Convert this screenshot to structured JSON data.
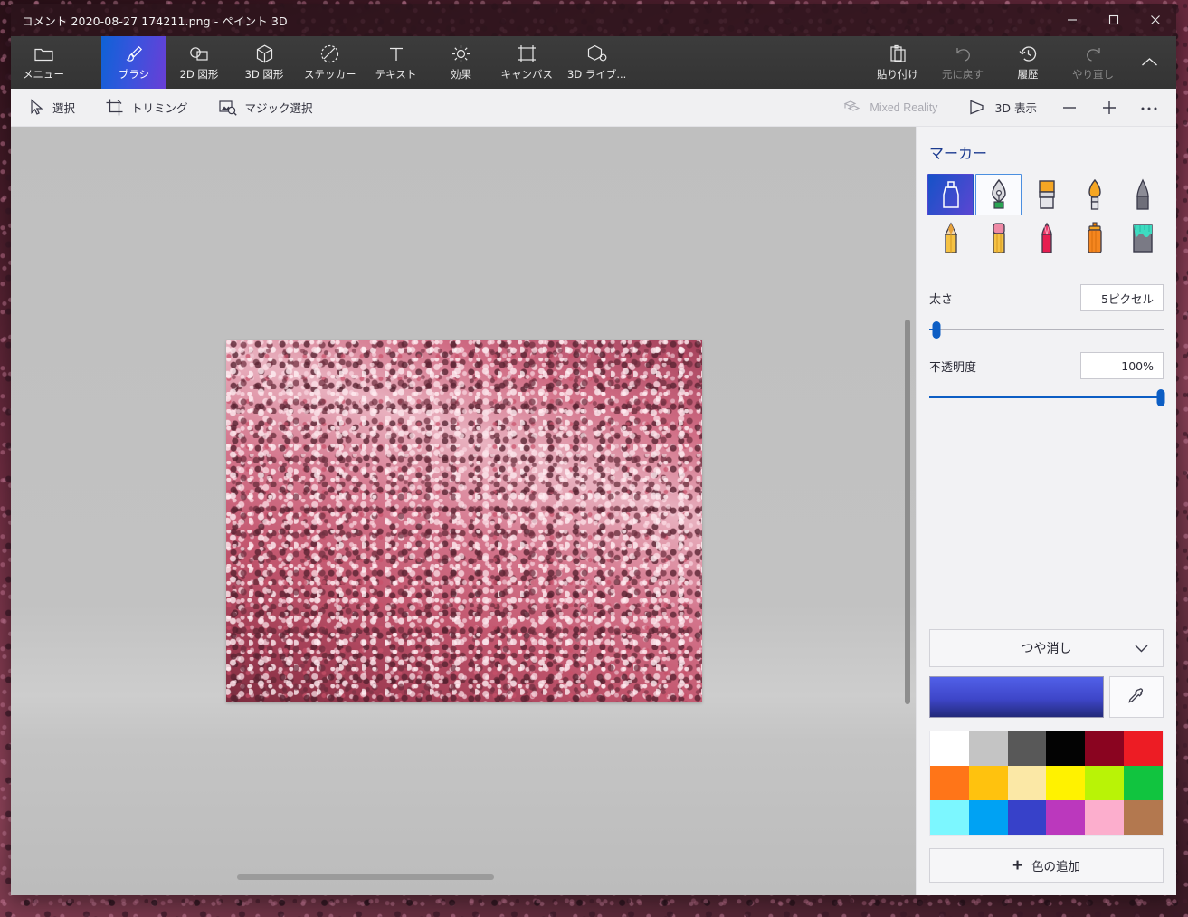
{
  "window": {
    "title": "コメント 2020-08-27 174211.png - ペイント 3D",
    "controls": [
      {
        "name": "minimize",
        "glyph": "minimize-icon"
      },
      {
        "name": "maximize",
        "glyph": "maximize-icon"
      },
      {
        "name": "close",
        "glyph": "close-icon"
      }
    ]
  },
  "ribbon": {
    "menu": {
      "label": "メニュー",
      "icon": "folder-icon"
    },
    "tools": [
      {
        "label": "ブラシ",
        "icon": "brush-icon",
        "active": true,
        "disabled": false
      },
      {
        "label": "2D 図形",
        "icon": "shapes-2d-icon",
        "active": false,
        "disabled": false
      },
      {
        "label": "3D 図形",
        "icon": "cube-3d-icon",
        "active": false,
        "disabled": false
      },
      {
        "label": "ステッカー",
        "icon": "sticker-icon",
        "active": false,
        "disabled": false
      },
      {
        "label": "テキスト",
        "icon": "text-icon",
        "active": false,
        "disabled": false
      },
      {
        "label": "効果",
        "icon": "effects-sun-icon",
        "active": false,
        "disabled": false
      },
      {
        "label": "キャンバス",
        "icon": "canvas-frame-icon",
        "active": false,
        "disabled": false
      },
      {
        "label": "3D ライブ...",
        "icon": "3d-library-icon",
        "active": false,
        "disabled": false
      }
    ],
    "right": [
      {
        "label": "貼り付け",
        "icon": "paste-icon",
        "disabled": false
      },
      {
        "label": "元に戻す",
        "icon": "undo-icon",
        "disabled": true
      },
      {
        "label": "履歴",
        "icon": "history-icon",
        "disabled": false
      },
      {
        "label": "やり直し",
        "icon": "redo-icon",
        "disabled": true
      }
    ],
    "collapse": {
      "icon": "chevron-up-icon"
    }
  },
  "subbar": {
    "left": [
      {
        "label": "選択",
        "icon": "cursor-select-icon",
        "disabled": false
      },
      {
        "label": "トリミング",
        "icon": "crop-icon",
        "disabled": false
      },
      {
        "label": "マジック選択",
        "icon": "magic-select-icon",
        "disabled": false
      }
    ],
    "right": [
      {
        "label": "Mixed Reality",
        "icon": "mixed-reality-icon",
        "disabled": true
      },
      {
        "label": "3D 表示",
        "icon": "view-3d-icon",
        "disabled": false
      }
    ],
    "zoom_out": {
      "icon": "minus-icon",
      "glyph": "—"
    },
    "zoom_in": {
      "icon": "plus-icon",
      "glyph": "+"
    },
    "more": {
      "icon": "more-ellipsis-icon",
      "glyph": "···"
    }
  },
  "panel": {
    "title": "マーカー",
    "brushes": [
      {
        "name": "marker-brush",
        "selected": true,
        "hovered": false
      },
      {
        "name": "calligraphy-pen-brush",
        "selected": false,
        "hovered": true
      },
      {
        "name": "oil-brush",
        "selected": false,
        "hovered": false
      },
      {
        "name": "watercolor-brush",
        "selected": false,
        "hovered": false
      },
      {
        "name": "pixel-pen-brush",
        "selected": false,
        "hovered": false
      },
      {
        "name": "pencil-brush",
        "selected": false,
        "hovered": false
      },
      {
        "name": "eraser-brush",
        "selected": false,
        "hovered": false
      },
      {
        "name": "crayon-brush",
        "selected": false,
        "hovered": false
      },
      {
        "name": "spray-can-brush",
        "selected": false,
        "hovered": false
      },
      {
        "name": "fill-bucket-brush",
        "selected": false,
        "hovered": false
      }
    ],
    "thickness": {
      "label": "太さ",
      "value": "5ピクセル",
      "percent": 3
    },
    "opacity": {
      "label": "不透明度",
      "value": "100%",
      "percent": 100
    },
    "material": {
      "label": "つや消し",
      "icon": "chevron-down-icon"
    },
    "current_color": {
      "name": "current-color-swatch",
      "from": "#5160e8",
      "to": "#232a7a"
    },
    "eyedropper": {
      "label": "",
      "icon": "eyedropper-icon"
    },
    "palette": [
      "#ffffff",
      "#c4c4c4",
      "#585858",
      "#030303",
      "#8a0420",
      "#ed1c24",
      "#ff7518",
      "#ffc20e",
      "#fbe8a6",
      "#fff200",
      "#b9f306",
      "#11c43f",
      "#7cf7ff",
      "#00a2f3",
      "#3741c9",
      "#bb38bd",
      "#fcaecd",
      "#b3784f"
    ],
    "add_color": {
      "label": "色の追加",
      "plus": "+"
    }
  }
}
